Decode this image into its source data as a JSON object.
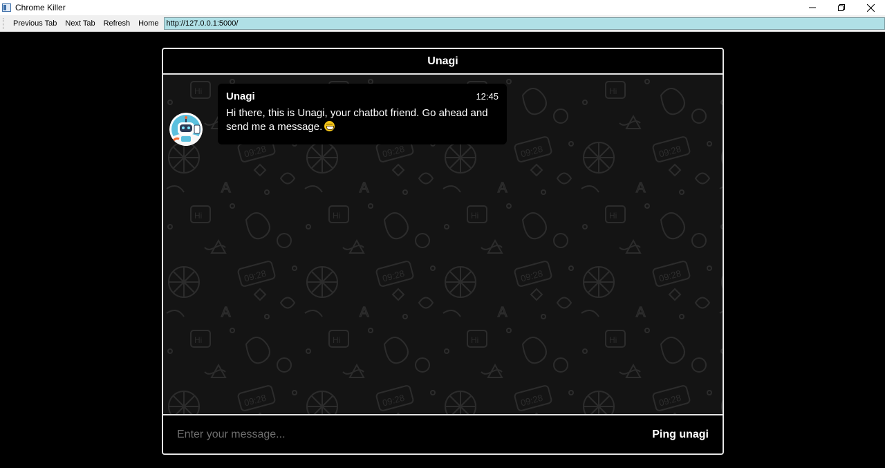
{
  "window": {
    "title": "Chrome Killer",
    "controls": {
      "minimize": "minimize-icon",
      "restore": "restore-icon",
      "close": "close-icon"
    }
  },
  "toolbar": {
    "previous_tab": "Previous Tab",
    "next_tab": "Next Tab",
    "refresh": "Refresh",
    "home": "Home",
    "url": "http://127.0.0.1:5000/"
  },
  "chat": {
    "header_title": "Unagi",
    "messages": [
      {
        "sender": "Unagi",
        "time": "12:45",
        "text": "Hi there, this is Unagi, your chatbot friend. Go ahead and send me a message.",
        "emoji": "grinning-face-emoji",
        "avatar": "robot-avatar"
      }
    ],
    "input_placeholder": "Enter your message...",
    "input_value": "",
    "send_label": "Ping unagi"
  },
  "colors": {
    "background": "#000000",
    "url_bar": "#b0e0e6",
    "border": "#e6e6e6",
    "chat_bg": "#141414",
    "bubble": "#000000"
  }
}
